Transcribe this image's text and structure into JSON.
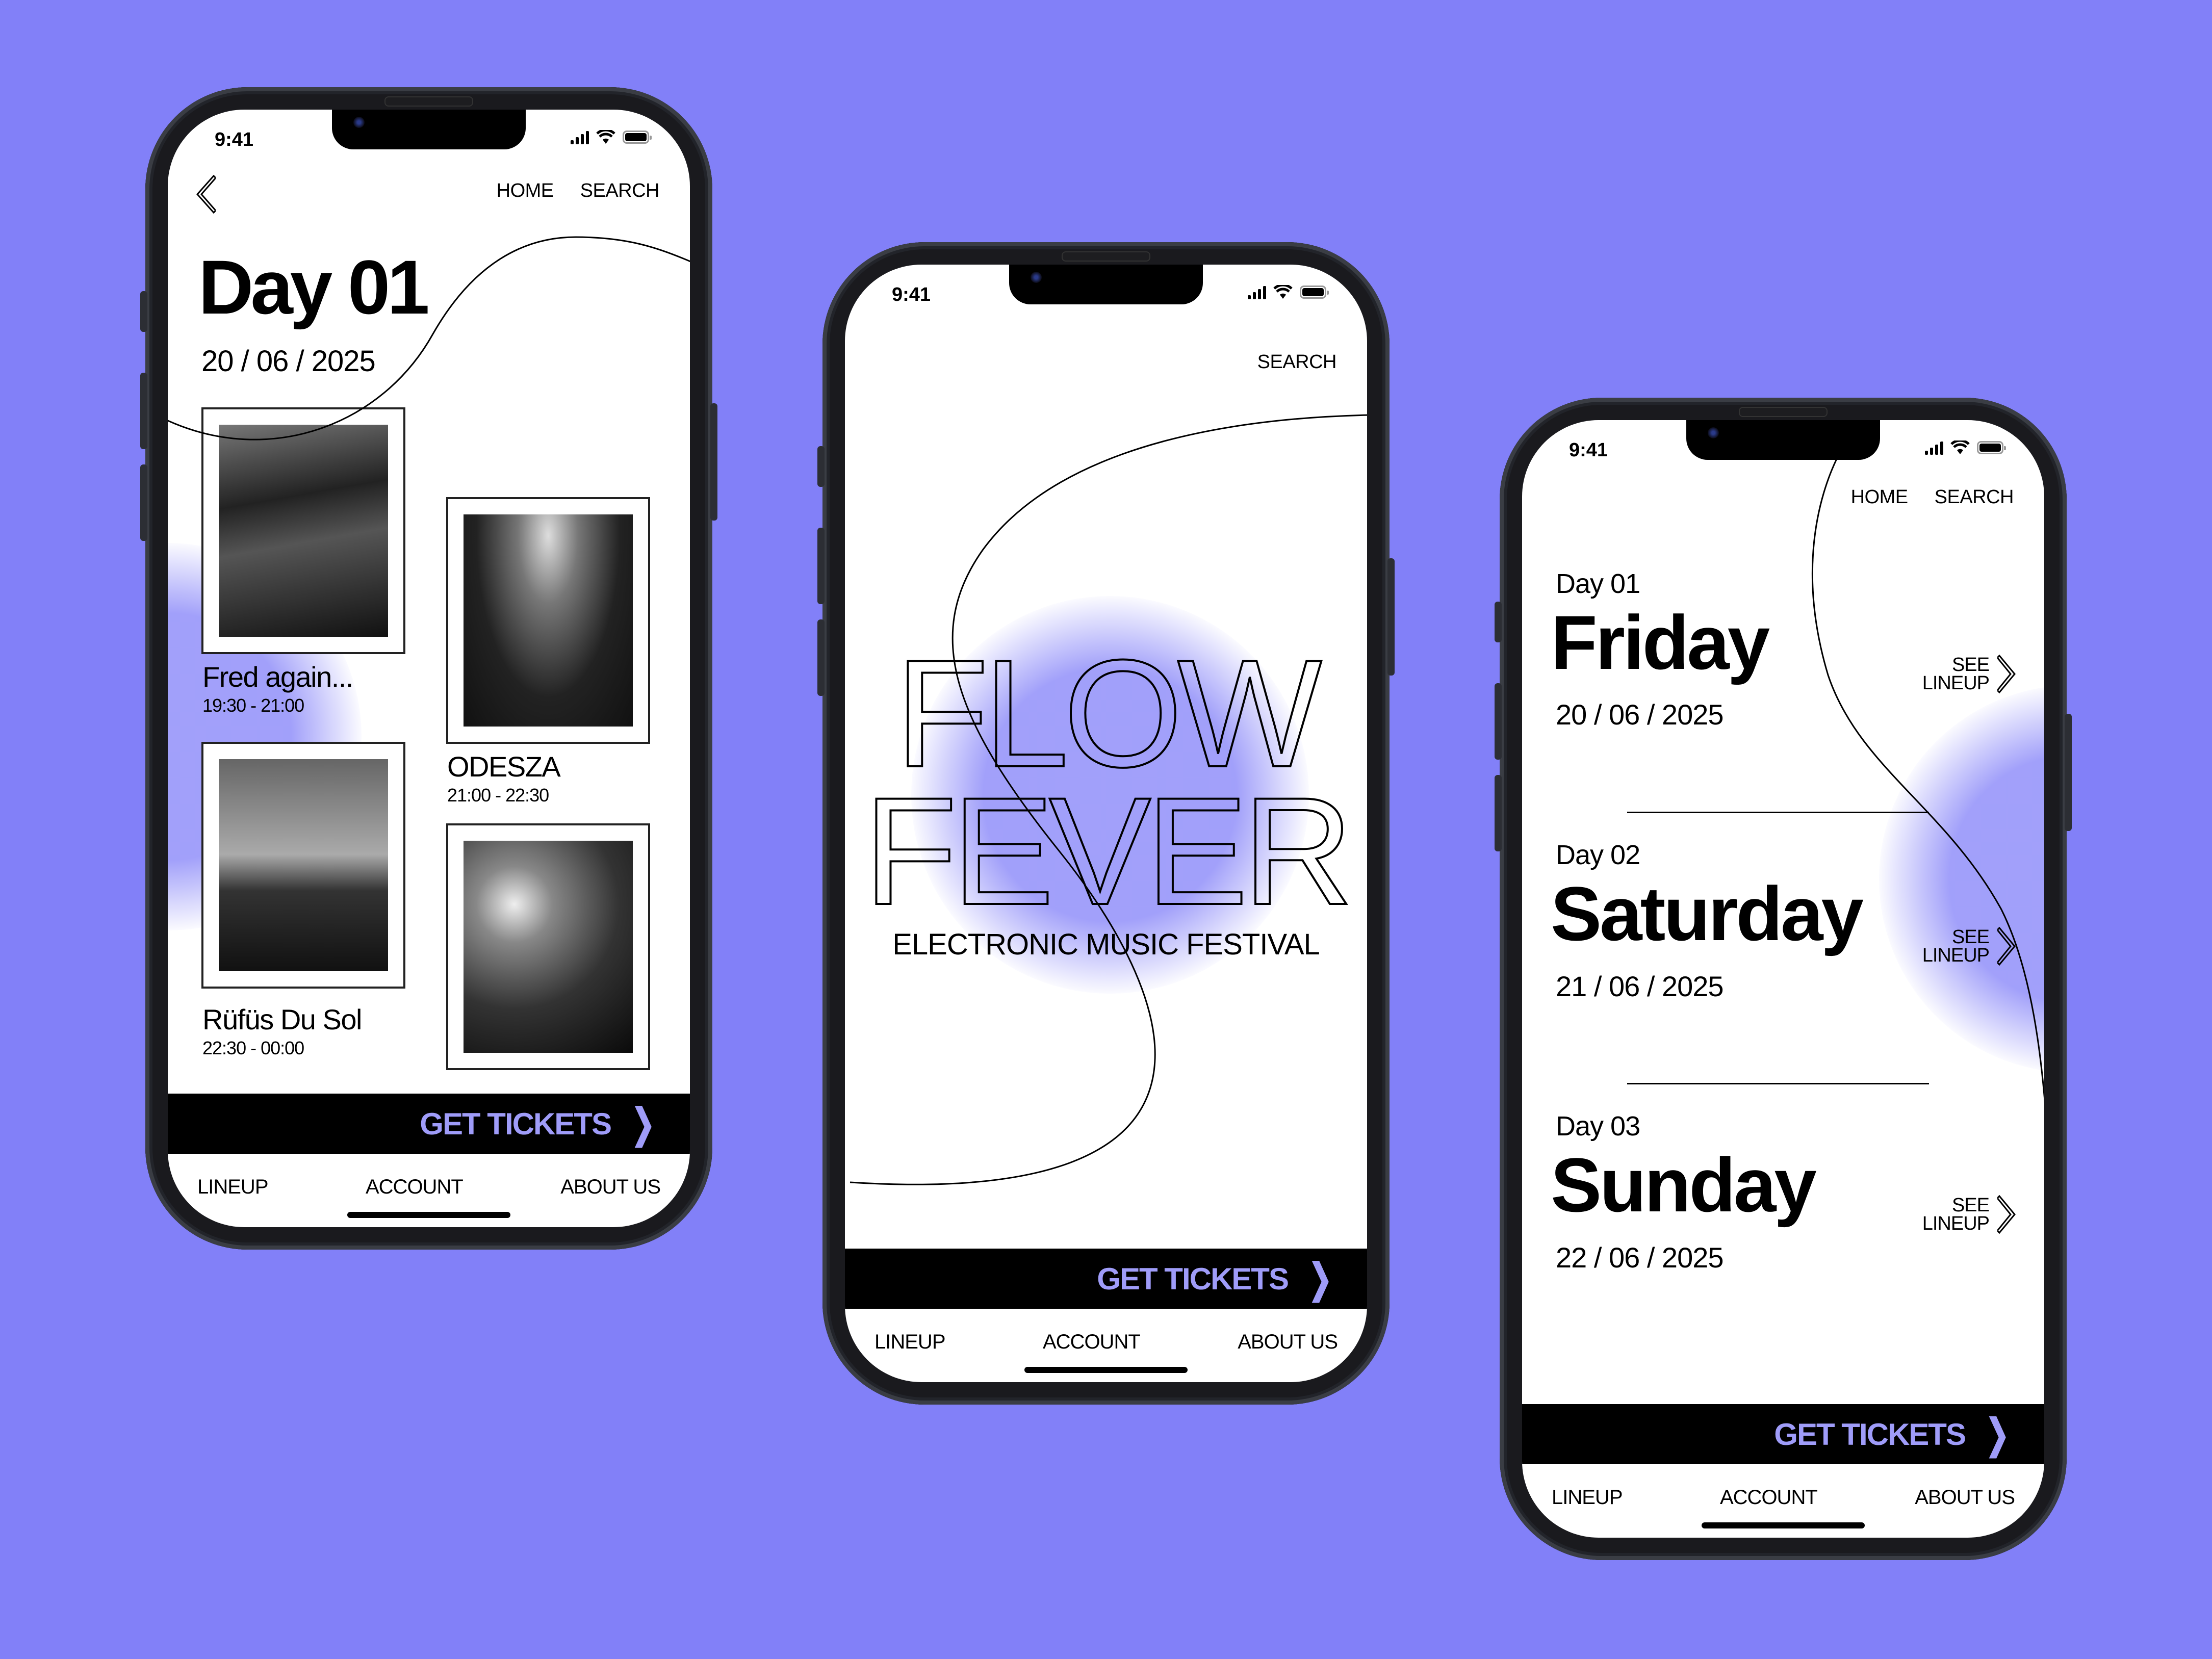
{
  "theme": {
    "background": "#8280f8",
    "accent": "#9f9cf9"
  },
  "status_bar": {
    "time": "9:41",
    "icons": [
      "cellular-signal-icon",
      "wifi-icon",
      "battery-icon"
    ]
  },
  "cta": {
    "label": "GET TICKETS",
    "icon": "chevron-right-icon"
  },
  "bottom_nav": [
    "LINEUP",
    "ACCOUNT",
    "ABOUT US"
  ],
  "phone1": {
    "back_icon": "chevron-left-icon",
    "nav": [
      "HOME",
      "SEARCH"
    ],
    "title": "Day 01",
    "date": "20 / 06 / 2025",
    "artists": [
      {
        "name": "Fred again...",
        "time": "19:30 - 21:00"
      },
      {
        "name": "ODESZA",
        "time": "21:00 - 22:30"
      },
      {
        "name": "Rüfüs Du Sol",
        "time": "22:30 - 00:00"
      },
      {
        "name": "",
        "time": ""
      }
    ]
  },
  "phone2": {
    "nav": [
      "SEARCH"
    ],
    "title_line1": "FLOW",
    "title_line2": "FEVER",
    "subtitle": "ELECTRONIC MUSIC FESTIVAL"
  },
  "phone3": {
    "nav": [
      "HOME",
      "SEARCH"
    ],
    "days": [
      {
        "label": "Day 01",
        "name": "Friday",
        "date": "20 / 06 / 2025",
        "link_line1": "SEE",
        "link_line2": "LINEUP"
      },
      {
        "label": "Day 02",
        "name": "Saturday",
        "date": "21 / 06 / 2025",
        "link_line1": "SEE",
        "link_line2": "LINEUP"
      },
      {
        "label": "Day 03",
        "name": "Sunday",
        "date": "22 / 06 / 2025",
        "link_line1": "SEE",
        "link_line2": "LINEUP"
      }
    ]
  }
}
